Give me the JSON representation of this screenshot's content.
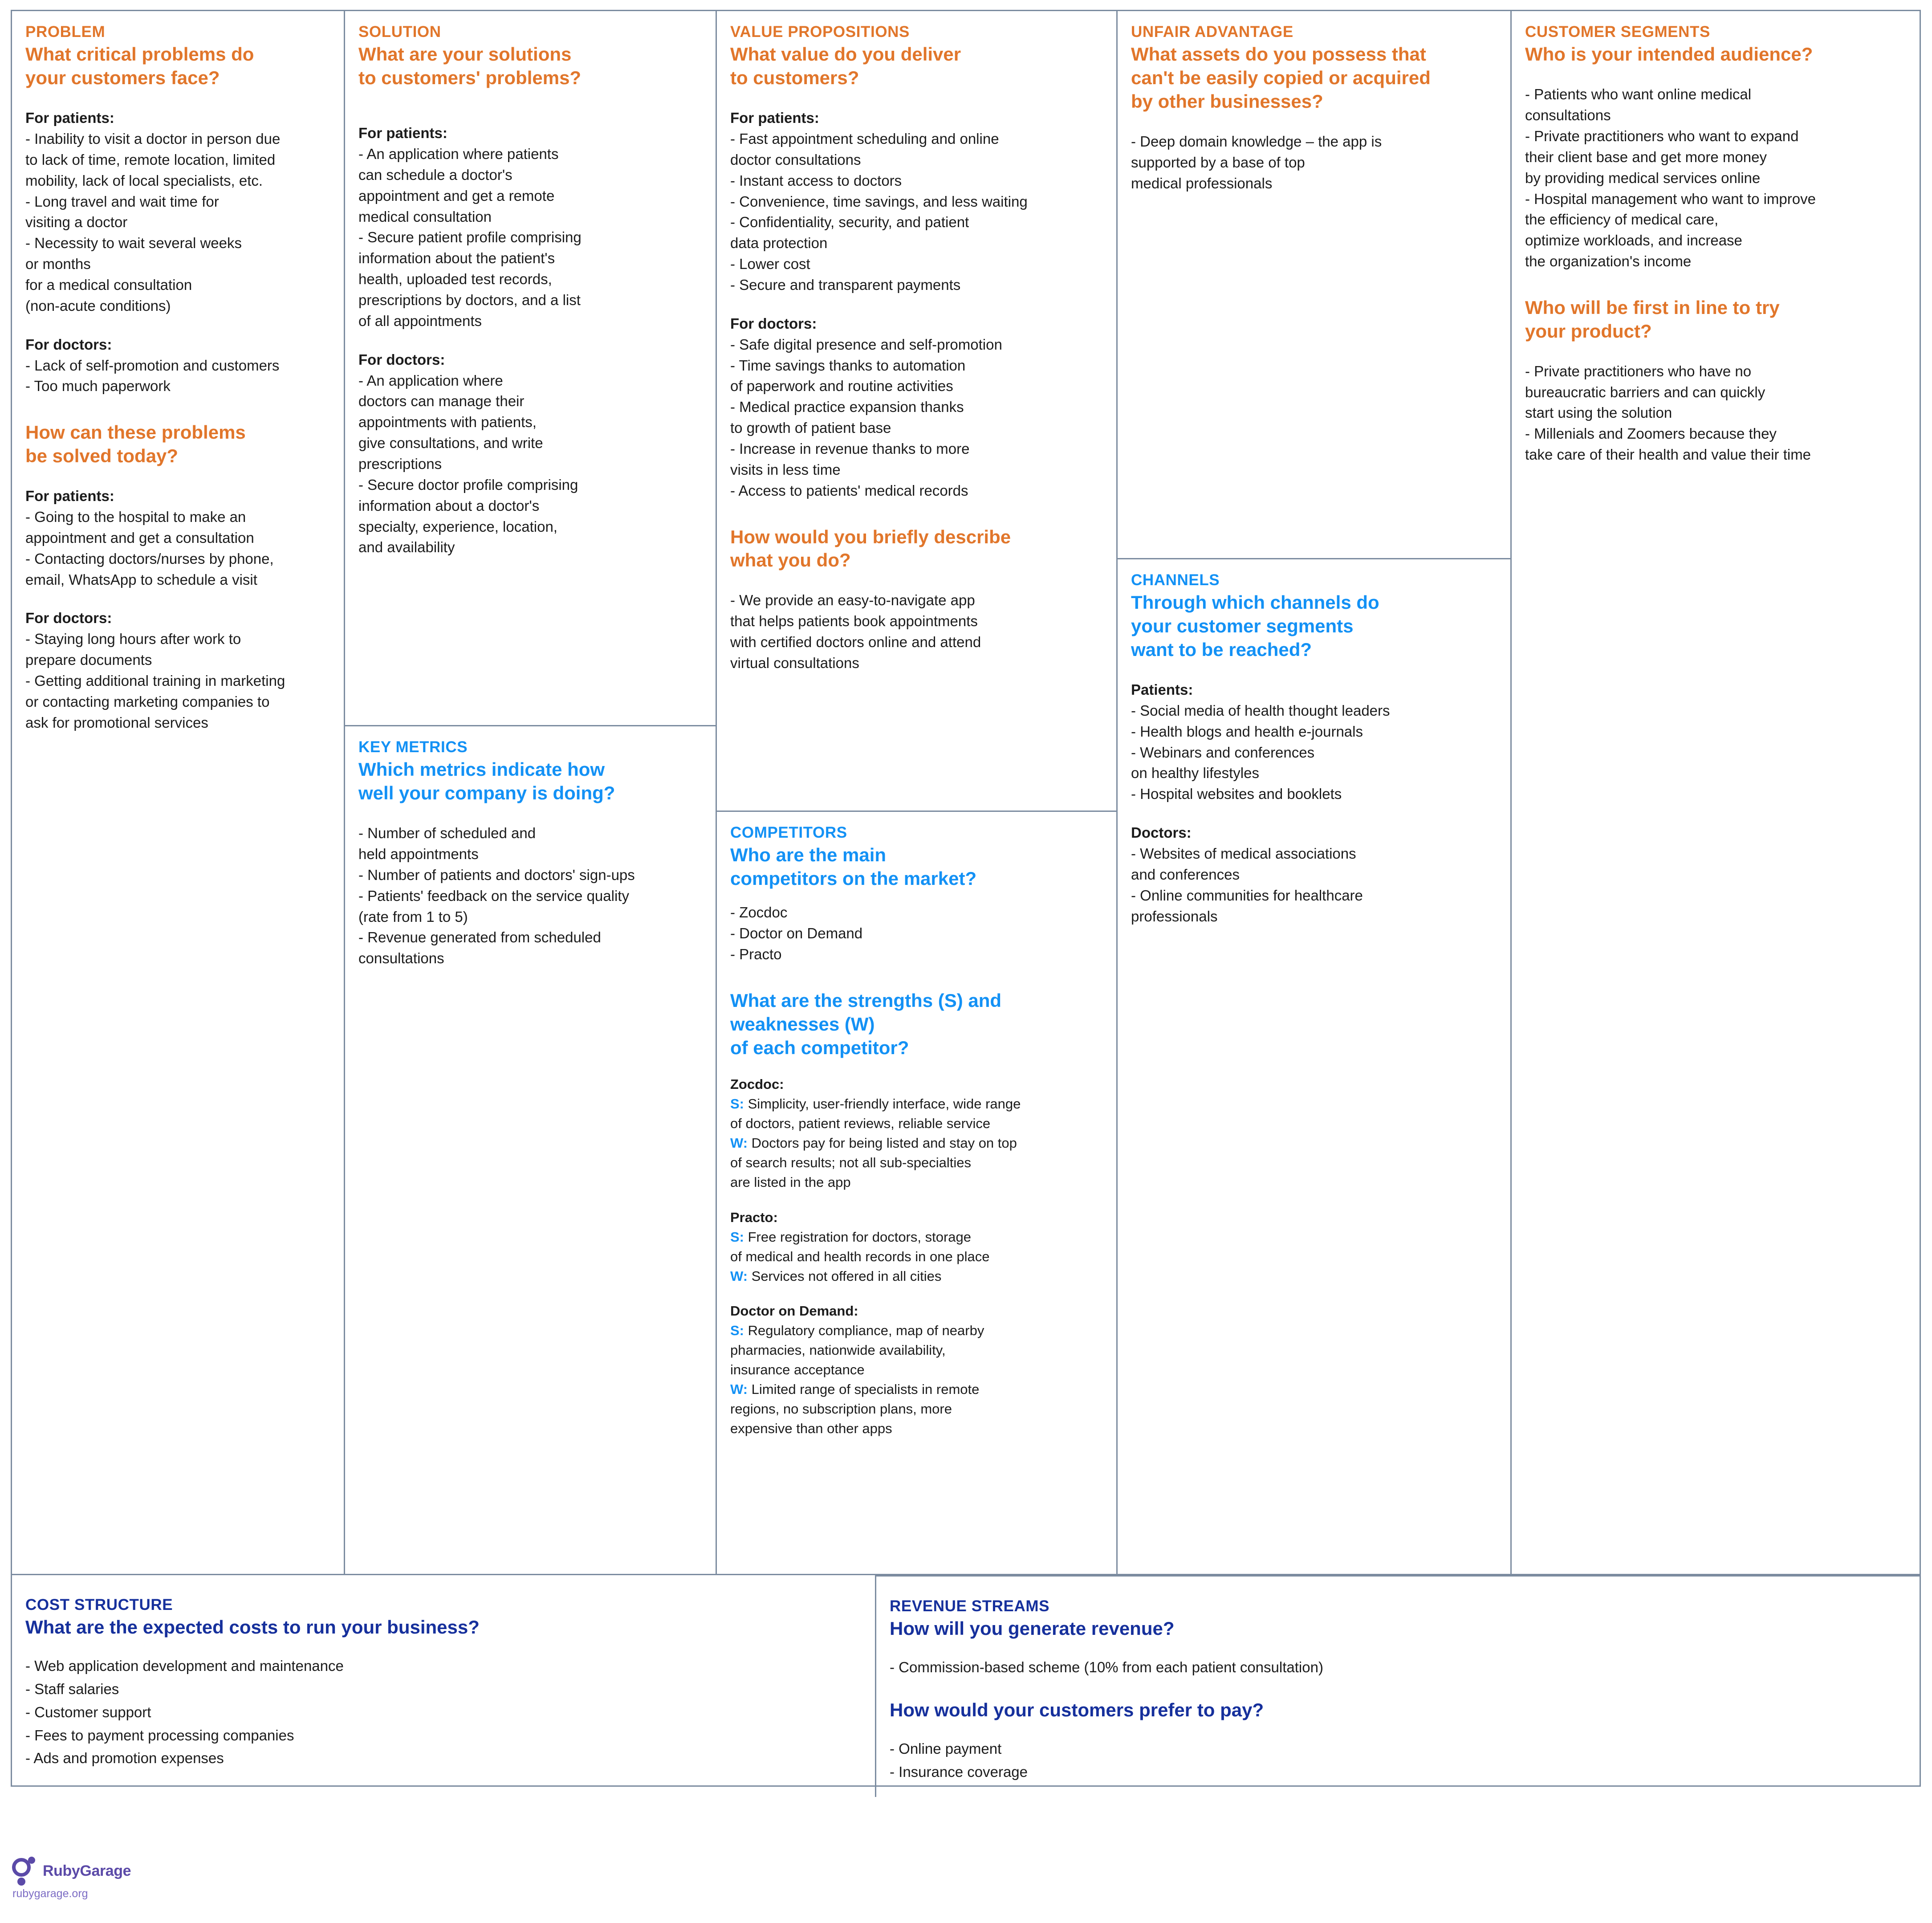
{
  "colors": {
    "orange": "#e1762b",
    "cyan": "#1391f5",
    "navy": "#16309c",
    "border": "#7c8ca0",
    "text": "#1c1c1c",
    "logo_purple": "#5b4aa8"
  },
  "problem": {
    "kicker": "PROBLEM",
    "title": "What critical problems do\nyour customers face?",
    "patients_label": "For patients:",
    "patients_items": "- Inability to visit a doctor in person due\nto lack of time, remote location, limited\nmobility, lack of local specialists, etc.\n- Long travel and wait time for\nvisiting a doctor\n- Necessity to wait several weeks\nor months\nfor a medical consultation\n(non-acute conditions)",
    "doctors_label": "For doctors:",
    "doctors_items": "- Lack of self-promotion and customers\n- Too much paperwork",
    "solved_title": "How can these problems\nbe solved today?",
    "solved_patients_label": "For patients:",
    "solved_patients_items": "- Going to the hospital to make an\nappointment and get a consultation\n- Contacting doctors/nurses by phone,\nemail, WhatsApp to schedule a visit",
    "solved_doctors_label": "For doctors:",
    "solved_doctors_items": "- Staying long hours after work to\nprepare documents\n- Getting additional training in marketing\nor contacting marketing companies to\nask for promotional services"
  },
  "solution": {
    "kicker": "SOLUTION",
    "title": "What are your solutions\nto customers' problems?",
    "patients_label": "For patients:",
    "patients_items": "- An application where patients\ncan schedule a doctor's\nappointment and get a remote\nmedical consultation\n- Secure patient profile comprising\ninformation about the patient's\nhealth, uploaded test records,\nprescriptions by doctors, and a list\nof all appointments",
    "doctors_label": "For doctors:",
    "doctors_items": "- An application where\ndoctors can manage their\nappointments with patients,\ngive consultations, and write\nprescriptions\n- Secure doctor profile comprising\ninformation about a doctor's\nspecialty, experience, location,\nand availability"
  },
  "key_metrics": {
    "kicker": "KEY METRICS",
    "title": "Which metrics indicate how\nwell your company is doing?",
    "items": "- Number of scheduled and\nheld appointments\n- Number of patients and doctors' sign-ups\n- Patients' feedback on the service quality\n(rate from 1 to 5)\n- Revenue generated from scheduled\nconsultations"
  },
  "value_propositions": {
    "kicker": "VALUE PROPOSITIONS",
    "title": "What value do you deliver\nto customers?",
    "patients_label": "For patients:",
    "patients_items": "- Fast appointment scheduling and online\ndoctor consultations\n- Instant access to doctors\n- Convenience, time savings, and less waiting\n- Confidentiality, security, and patient\ndata protection\n- Lower cost\n- Secure and transparent payments",
    "doctors_label": "For doctors:",
    "doctors_items": "- Safe digital presence and self-promotion\n- Time savings thanks to automation\nof paperwork and routine activities\n- Medical practice expansion thanks\nto growth of patient base\n- Increase in revenue thanks to more\nvisits in less time\n- Access to patients' medical records",
    "describe_title": "How would you briefly describe\nwhat you do?",
    "describe_items": "- We provide an easy-to-navigate app\nthat helps patients book appointments\nwith certified doctors online and attend\nvirtual consultations"
  },
  "competitors": {
    "kicker": "COMPETITORS",
    "title": "Who are the main\ncompetitors on the market?",
    "items": "- Zocdoc\n- Doctor on Demand\n- Practo",
    "swot_title": "What are the strengths (S) and\nweaknesses (W)\nof each competitor?",
    "swot": [
      {
        "name": "Zocdoc:",
        "s_tag": "S:",
        "s_text": " Simplicity, user-friendly interface, wide range\nof doctors, patient reviews, reliable service",
        "w_tag": "W:",
        "w_text": " Doctors pay for being listed and stay on top\nof search results; not all sub-specialties\nare listed in the app"
      },
      {
        "name": "Practo:",
        "s_tag": "S:",
        "s_text": " Free registration for doctors, storage\nof medical and health records in one place",
        "w_tag": "W:",
        "w_text": " Services not offered in all cities"
      },
      {
        "name": "Doctor on Demand:",
        "s_tag": "S:",
        "s_text": " Regulatory compliance, map of nearby\npharmacies, nationwide availability,\ninsurance acceptance",
        "w_tag": "W:",
        "w_text": " Limited range of specialists in remote\nregions, no subscription plans, more\nexpensive than other apps"
      }
    ]
  },
  "unfair_advantage": {
    "kicker": "UNFAIR ADVANTAGE",
    "title": "What assets do you possess that\ncan't be easily copied or acquired\nby other businesses?",
    "items": "- Deep domain knowledge – the app is\nsupported by a base of top\nmedical professionals"
  },
  "channels": {
    "kicker": "CHANNELS",
    "title": "Through which channels do\nyour customer segments\nwant to be reached?",
    "patients_label": "Patients:",
    "patients_items": "- Social media of health thought leaders\n- Health blogs and health e-journals\n- Webinars and conferences\non healthy lifestyles\n- Hospital websites and booklets",
    "doctors_label": "Doctors:",
    "doctors_items": "- Websites of medical associations\nand conferences\n- Online communities for healthcare\nprofessionals"
  },
  "customer_segments": {
    "kicker": "CUSTOMER SEGMENTS",
    "title": "Who is your intended audience?",
    "items": "- Patients who want online medical\nconsultations\n- Private practitioners who want to expand\ntheir client base and get more money\nby providing medical services online\n- Hospital management who want to improve\nthe efficiency of medical care,\noptimize workloads, and increase\nthe organization's income",
    "first_title": "Who will be first in line to try\nyour product?",
    "first_items": "- Private practitioners who have no\nbureaucratic barriers and can quickly\nstart using the solution\n- Millenials and Zoomers because they\ntake care of their health and value their time"
  },
  "cost_structure": {
    "kicker": "COST STRUCTURE",
    "title": "What are the expected costs to run your business?",
    "items": "- Web application development and maintenance\n- Staff salaries\n- Customer support\n- Fees to payment processing companies\n- Ads and promotion expenses"
  },
  "revenue_streams": {
    "kicker": "REVENUE STREAMS",
    "title": "How will you generate revenue?",
    "items": "- Commission-based scheme (10% from each patient consultation)",
    "pay_title": "How would your customers prefer to pay?",
    "pay_items": "- Online payment\n- Insurance coverage"
  },
  "footer": {
    "brand": "RubyGarage",
    "url": "rubygarage.org"
  }
}
